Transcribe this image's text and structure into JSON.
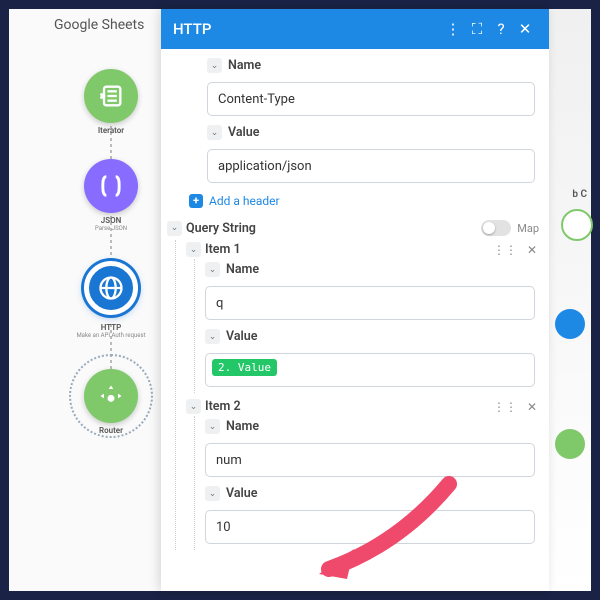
{
  "breadcrumb": "Google Sheets",
  "nodes": {
    "iterator": {
      "label": "Iterator"
    },
    "json": {
      "label": "JSON",
      "sub": "Parse JSON"
    },
    "http": {
      "label": "HTTP",
      "sub": "Make an API Auth request"
    },
    "router": {
      "label": "Router"
    }
  },
  "panel": {
    "title": "HTTP",
    "header_name": {
      "label": "Name",
      "value": "Content-Type"
    },
    "header_value": {
      "label": "Value",
      "value": "application/json"
    },
    "add_header": "Add a header",
    "query_section": "Query String",
    "map_label": "Map",
    "item1": {
      "title": "Item 1",
      "name_label": "Name",
      "name_value": "q",
      "value_label": "Value",
      "value_tag": "2. Value"
    },
    "item2": {
      "title": "Item 2",
      "name_label": "Name",
      "name_value": "num",
      "value_label": "Value",
      "value_value": "10"
    }
  },
  "right_label": "b C"
}
